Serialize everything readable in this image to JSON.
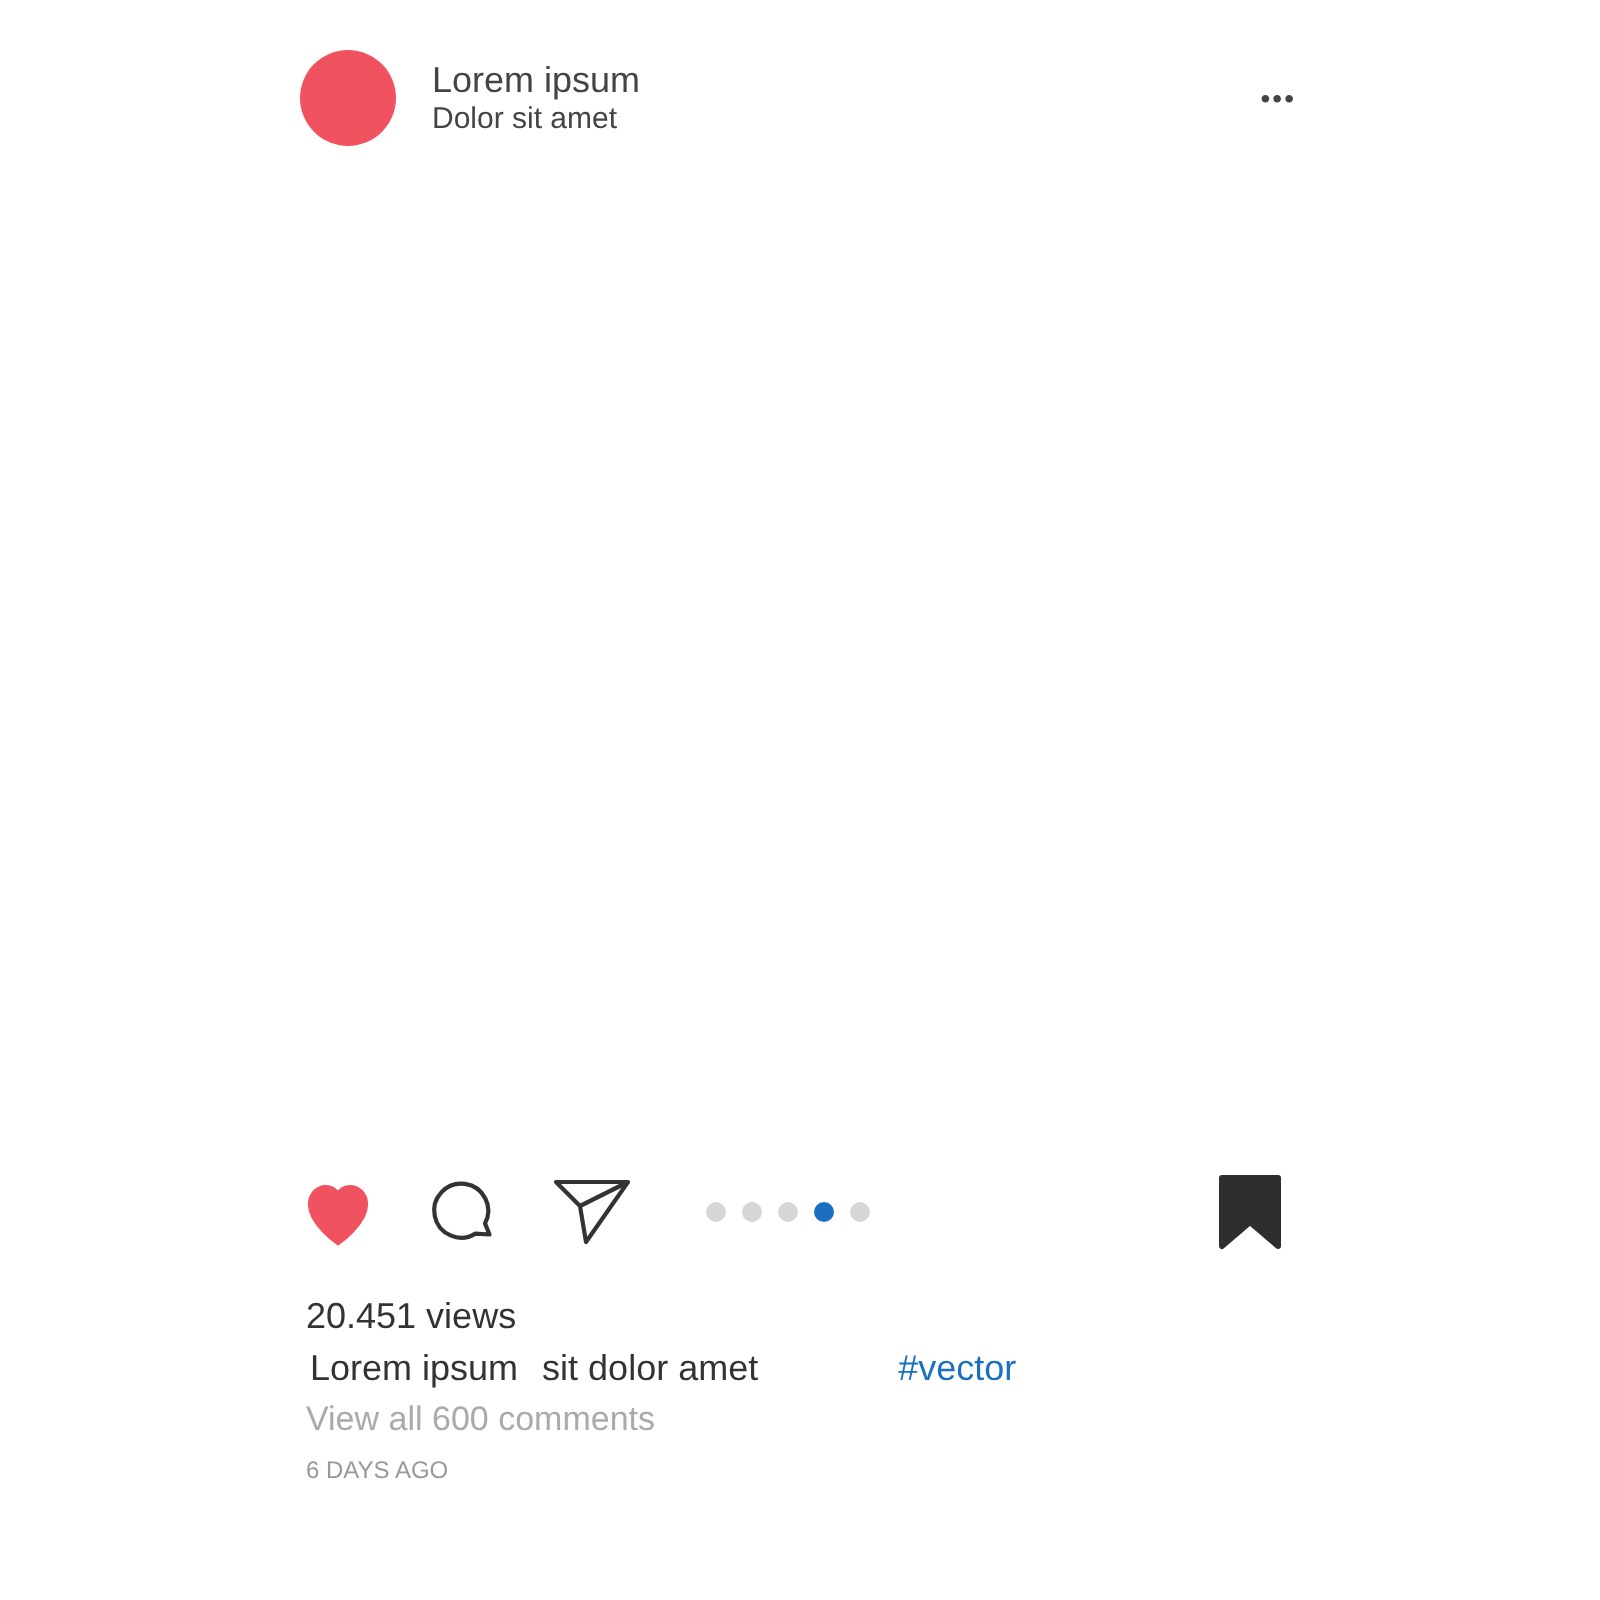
{
  "post": {
    "author": "Lorem ipsum",
    "subtitle": "Dolor sit amet",
    "menu": "•••"
  },
  "actions": {
    "liked": true,
    "saved": true
  },
  "pager": [
    {
      "selected": false
    },
    {
      "selected": false
    },
    {
      "selected": false
    },
    {
      "selected": true
    },
    {
      "selected": false
    }
  ],
  "views": "20.451 views",
  "caption": {
    "user": "Lorem ipsum",
    "text": "sit dolor amet",
    "hashtag": "#vector"
  },
  "comments_link": "View all 600 comments",
  "time": "6 DAYS AGO"
}
